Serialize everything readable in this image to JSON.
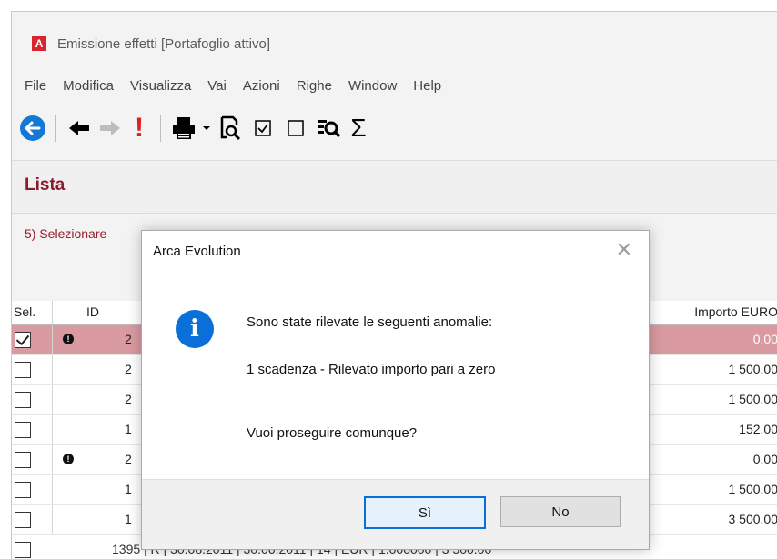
{
  "window": {
    "title": "Emissione effetti [Portafoglio attivo]",
    "app_icon_letter": "A"
  },
  "menu": [
    "File",
    "Modifica",
    "Visualizza",
    "Vai",
    "Azioni",
    "Righe",
    "Window",
    "Help"
  ],
  "toolbar": {
    "icons": [
      "back-circle-icon",
      "arrow-left-icon",
      "arrow-right-icon",
      "exclamation-icon",
      "printer-icon",
      "dropdown-caret-icon",
      "preview-icon",
      "checkbox-checked-icon",
      "checkbox-empty-icon",
      "list-search-icon",
      "sigma-icon"
    ],
    "exclamation": "!",
    "sigma": "Σ"
  },
  "section": {
    "title": "Lista",
    "hint": "5) Selezionare"
  },
  "grid": {
    "headers": {
      "sel": "Sel.",
      "id": "ID",
      "amount": "Importo EURO"
    },
    "rows": [
      {
        "checked": true,
        "warn": true,
        "id": "2",
        "amount": "0.00",
        "selected": true
      },
      {
        "checked": false,
        "warn": false,
        "id": "2",
        "amount": "1 500.00",
        "selected": false
      },
      {
        "checked": false,
        "warn": false,
        "id": "2",
        "amount": "1 500.00",
        "selected": false
      },
      {
        "checked": false,
        "warn": false,
        "id": "1",
        "amount": "152.00",
        "selected": false
      },
      {
        "checked": false,
        "warn": true,
        "id": "2",
        "amount": "0.00",
        "selected": false
      },
      {
        "checked": false,
        "warn": false,
        "id": "1",
        "amount": "1 500.00",
        "selected": false
      },
      {
        "checked": false,
        "warn": false,
        "id": "1",
        "amount": "3 500.00",
        "selected": false
      }
    ],
    "partial_row": "1395 | R | 30.08.2011 | 30.06.2011 | 14 | EUR | 1.000000 | 3 500.00"
  },
  "dialog": {
    "title": "Arca Evolution",
    "close": "✕",
    "line1": "Sono state rilevate le seguenti anomalie:",
    "line2": "1 scadenza - Rilevato importo pari a zero",
    "line3": "Vuoi proseguire comunque?",
    "yes": "Sì",
    "no": "No",
    "info_glyph": "i"
  }
}
